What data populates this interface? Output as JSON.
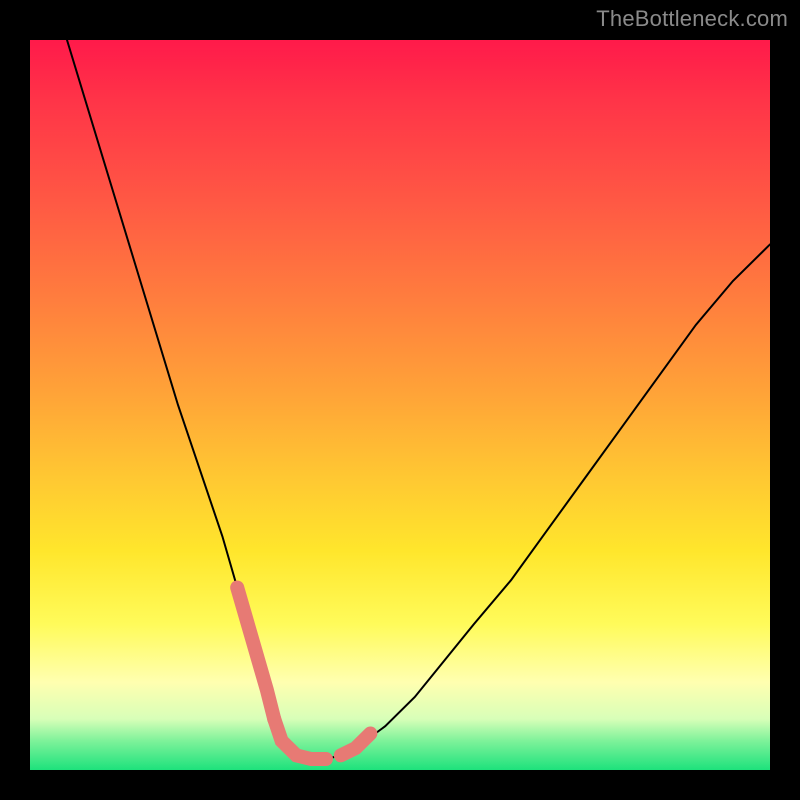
{
  "watermark": "TheBottleneck.com",
  "chart_data": {
    "type": "line",
    "title": "",
    "xlabel": "",
    "ylabel": "",
    "xlim": [
      0,
      100
    ],
    "ylim": [
      0,
      100
    ],
    "grid": false,
    "legend": false,
    "note": "Single unlabeled V-shaped curve over a rainbow gradient. Axes have no ticks or labels. Values are normalized 0–100 in each direction (0,0 bottom-left of colored area). The curve drops from top-left, bottoms out near x≈33–40, then rises to the right edge.",
    "series": [
      {
        "name": "bottleneck-curve",
        "color": "#000000",
        "x": [
          5,
          8,
          11,
          14,
          17,
          20,
          23,
          26,
          28,
          30,
          32,
          33,
          34,
          36,
          38,
          40,
          42,
          44,
          48,
          52,
          56,
          60,
          65,
          70,
          75,
          80,
          85,
          90,
          95,
          100
        ],
        "y": [
          100,
          90,
          80,
          70,
          60,
          50,
          41,
          32,
          25,
          18,
          11,
          7,
          4,
          2,
          1.5,
          1.5,
          2,
          3,
          6,
          10,
          15,
          20,
          26,
          33,
          40,
          47,
          54,
          61,
          67,
          72
        ]
      }
    ],
    "highlight_segments": {
      "note": "Thick salmon stroke overlaid on the curve near the minimum (two short descending/ascending stubs and a flat bottom).",
      "color": "#e77a74",
      "width": 14,
      "left_descent": {
        "x": [
          28,
          30,
          32,
          33
        ],
        "y": [
          25,
          18,
          11,
          7
        ]
      },
      "bottom": {
        "x": [
          33,
          34,
          36,
          38,
          40
        ],
        "y": [
          7,
          4,
          2,
          1.5,
          1.5
        ]
      },
      "right_ascent": {
        "x": [
          42,
          44,
          46
        ],
        "y": [
          2,
          3,
          5
        ]
      }
    }
  }
}
